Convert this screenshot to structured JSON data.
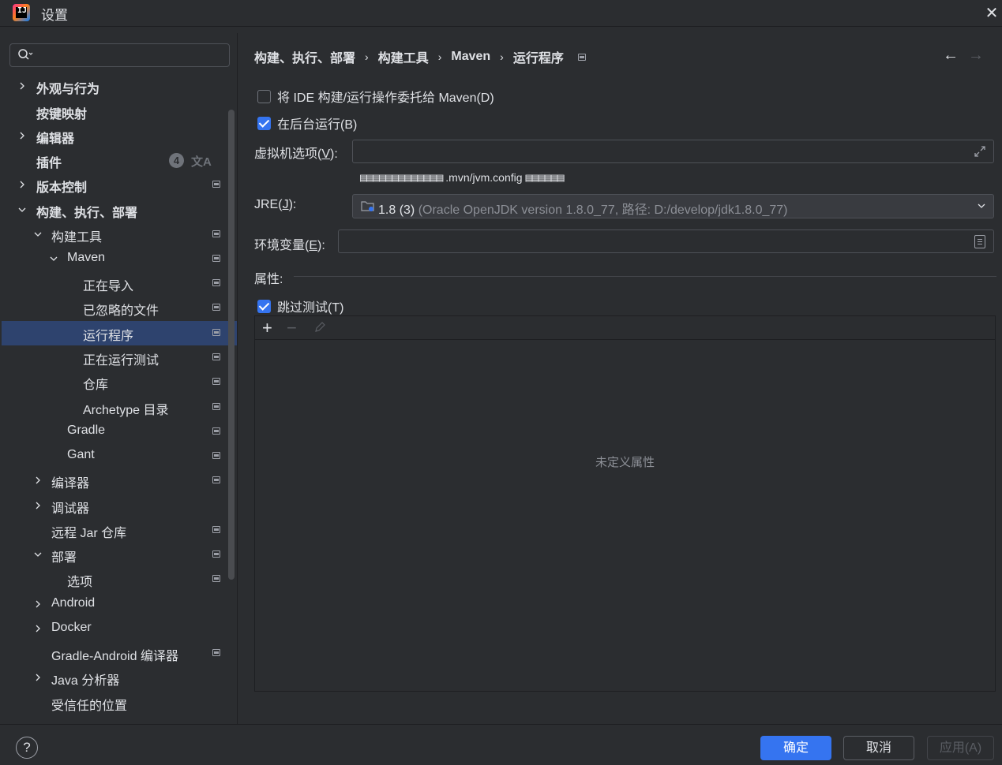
{
  "window": {
    "title": "设置",
    "logo_text": "IJ",
    "close_icon": "close-icon"
  },
  "search": {
    "placeholder": ""
  },
  "sidebar": {
    "items": [
      {
        "label": "外观与行为",
        "arrow": "›",
        "bold": true
      },
      {
        "label": "按键映射",
        "arrow": "",
        "bold": true
      },
      {
        "label": "编辑器",
        "arrow": "›",
        "bold": true
      },
      {
        "label": "插件",
        "arrow": "",
        "bold": true,
        "badge": "4",
        "badge_extra": "文A"
      },
      {
        "label": "版本控制",
        "arrow": "›",
        "bold": true
      },
      {
        "label": "构建、执行、部署",
        "arrow": "⌄",
        "bold": true
      },
      {
        "label": "构建工具",
        "arrow": "⌄"
      },
      {
        "label": "Maven",
        "arrow": "⌄"
      },
      {
        "label": "正在导入"
      },
      {
        "label": "已忽略的文件"
      },
      {
        "label": "运行程序",
        "selected": true
      },
      {
        "label": "正在运行测试"
      },
      {
        "label": "仓库"
      },
      {
        "label": "Archetype 目录"
      },
      {
        "label": "Gradle"
      },
      {
        "label": "Gant"
      },
      {
        "label": "编译器",
        "arrow": "›"
      },
      {
        "label": "调试器",
        "arrow": "›"
      },
      {
        "label": "远程 Jar 仓库"
      },
      {
        "label": "部署",
        "arrow": "⌄"
      },
      {
        "label": "选项"
      },
      {
        "label": "Android",
        "arrow": "›"
      },
      {
        "label": "Docker",
        "arrow": "›"
      },
      {
        "label": "Gradle-Android 编译器"
      },
      {
        "label": "Java 分析器",
        "arrow": "›"
      },
      {
        "label": "受信任的位置"
      }
    ]
  },
  "breadcrumb": {
    "items": [
      "构建、执行、部署",
      "构建工具",
      "Maven",
      "运行程序"
    ],
    "separator": "›"
  },
  "nav": {
    "back": "←",
    "forward": "→"
  },
  "form": {
    "delegate_checkbox": {
      "label": "将 IDE 构建/运行操作委托给 Maven(D)",
      "checked": false
    },
    "background_checkbox": {
      "label": "在后台运行(B)",
      "checked": true
    },
    "vm_options": {
      "label_pre": "虚拟机选项(",
      "label_key": "V",
      "label_post": "):",
      "value": ""
    },
    "vm_hint": {
      "garble_left": "▤▤▤▤▤▤▤▤▤▤▤▤▤",
      "config": ".mvn/jvm.config",
      "garble_right": "▤▤▤▤▤▤"
    },
    "jre": {
      "label_pre": "JRE(",
      "label_key": "J",
      "label_post": "):",
      "value_main": "1.8 (3)",
      "value_detail": "(Oracle OpenJDK version 1.8.0_77, 路径: D:/develop/jdk1.8.0_77)"
    },
    "env": {
      "label_pre": "环境变量(",
      "label_key": "E",
      "label_post": "):",
      "value": ""
    },
    "properties_title": "属性:",
    "skip_tests_checkbox": {
      "label": "跳过测试(T)",
      "checked": true
    },
    "properties_toolbar": {
      "add": "+",
      "remove": "−"
    },
    "properties_empty": "未定义属性"
  },
  "footer": {
    "help": "?",
    "ok": "确定",
    "cancel": "取消",
    "apply": "应用(A)"
  },
  "colors": {
    "background": "#2b2d30",
    "accent": "#3574f0",
    "selection": "#2e436e",
    "text": "#dfe1e5",
    "muted": "#8c8f96"
  }
}
